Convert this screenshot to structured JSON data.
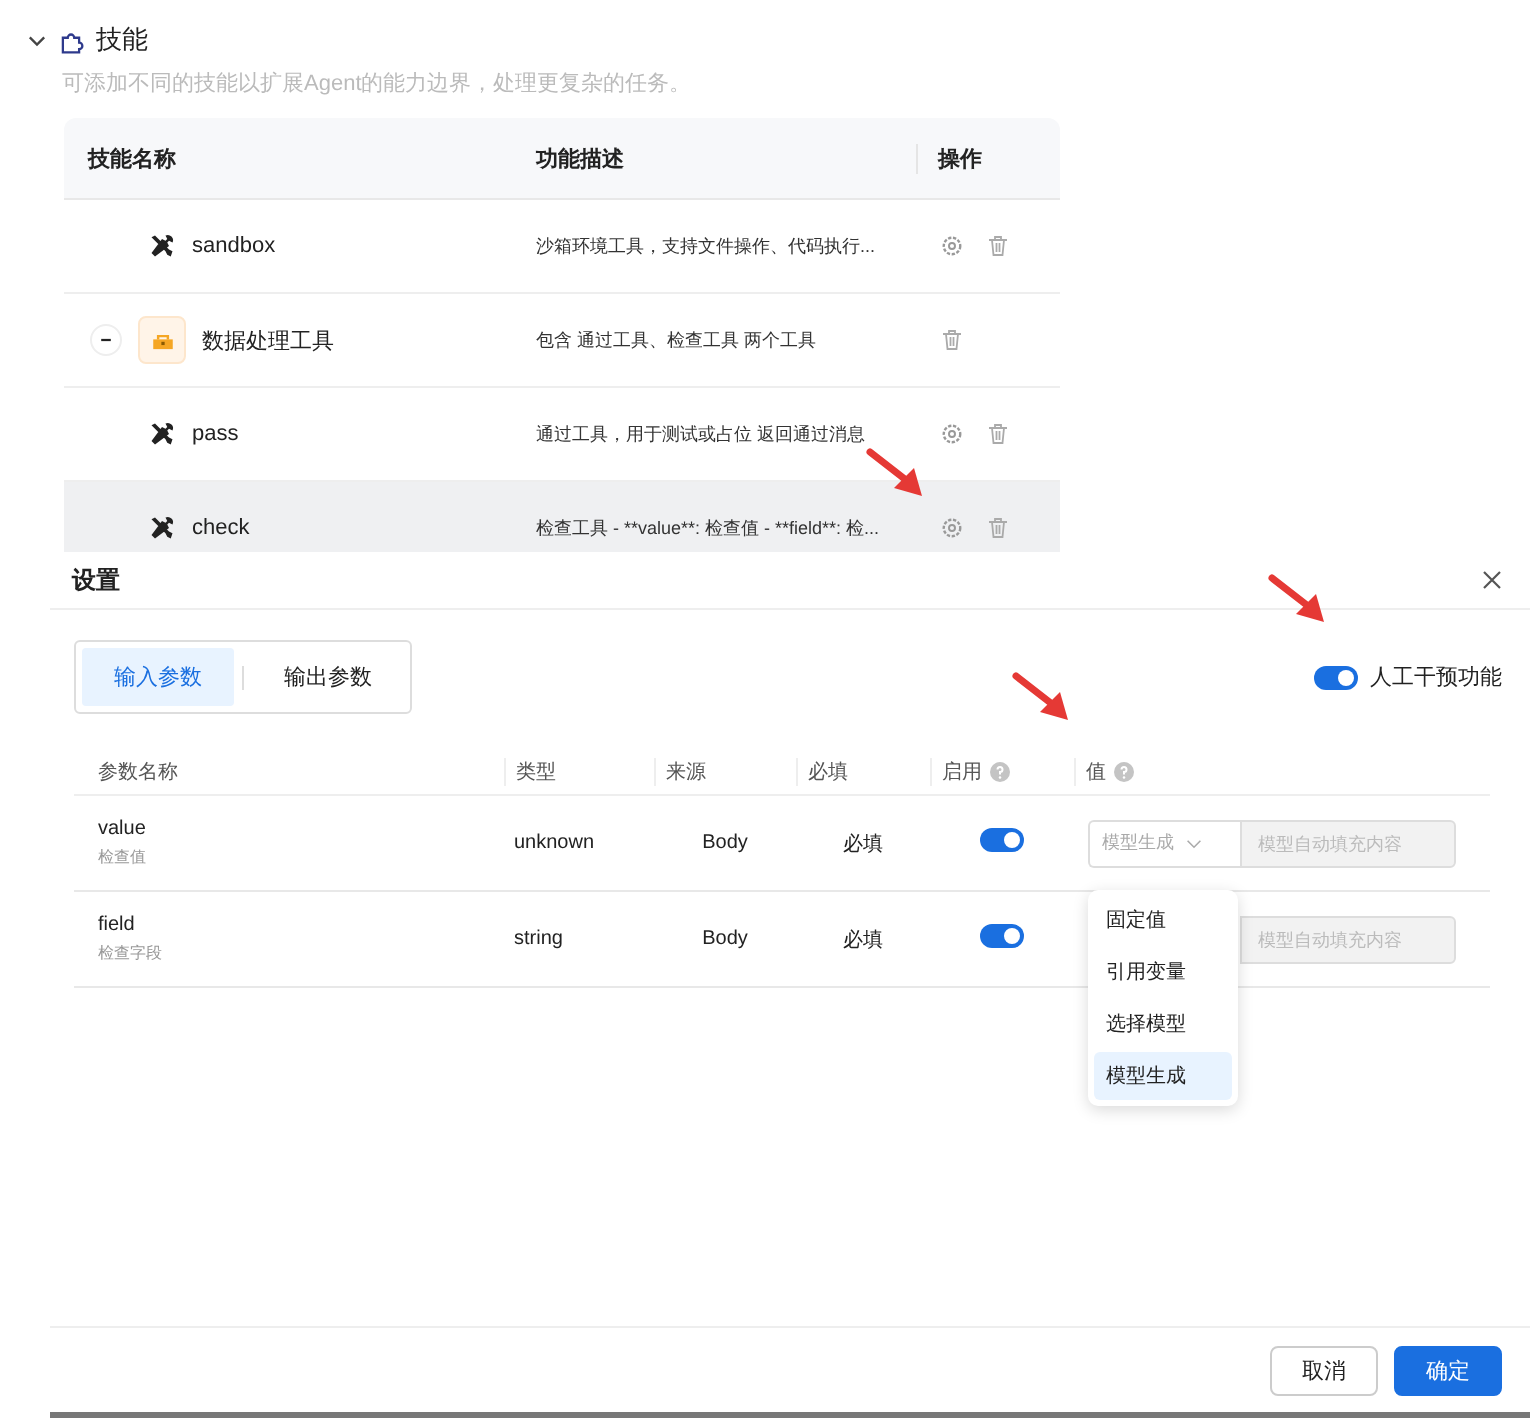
{
  "section": {
    "title": "技能",
    "expanded": true,
    "description": "可添加不同的技能以扩展Agent的能力边界，处理更复杂的任务。"
  },
  "skills_table": {
    "columns": [
      "技能名称",
      "功能描述",
      "操作"
    ],
    "rows": [
      {
        "kind": "tool",
        "name": "sandbox",
        "description": "沙箱环境工具，支持文件操作、代码执行...",
        "hovered": false
      },
      {
        "kind": "group",
        "name": "数据处理工具",
        "expanded": true,
        "description": "包含 通过工具、检查工具 两个工具",
        "hovered": false
      },
      {
        "kind": "tool",
        "name": "pass",
        "description": "通过工具，用于测试或占位 返回通过消息",
        "hovered": false
      },
      {
        "kind": "tool",
        "name": "check",
        "description": "检查工具 - **value**: 检查值 - **field**: 检...",
        "hovered": true
      }
    ]
  },
  "dialog": {
    "title": "设置",
    "tabs": [
      {
        "label": "输入参数",
        "selected": true
      },
      {
        "label": "输出参数",
        "selected": false
      }
    ],
    "manual_intervention": {
      "label": "人工干预功能",
      "on": true
    },
    "params_table": {
      "columns": [
        {
          "label": "参数名称",
          "help": false
        },
        {
          "label": "类型",
          "help": false
        },
        {
          "label": "来源",
          "help": false
        },
        {
          "label": "必填",
          "help": false
        },
        {
          "label": "启用",
          "help": true
        },
        {
          "label": "值",
          "help": true
        }
      ],
      "rows": [
        {
          "name": "value",
          "description": "检查值",
          "type": "unknown",
          "source": "Body",
          "required": "必填",
          "enabled": true,
          "value_mode": "模型生成",
          "value_placeholder": "模型自动填充内容"
        },
        {
          "name": "field",
          "description": "检查字段",
          "type": "string",
          "source": "Body",
          "required": "必填",
          "enabled": true,
          "value_placeholder": "模型自动填充内容"
        }
      ]
    },
    "value_mode_menu": {
      "items": [
        {
          "label": "固定值",
          "selected": false
        },
        {
          "label": "引用变量",
          "selected": false
        },
        {
          "label": "选择模型",
          "selected": false
        },
        {
          "label": "模型生成",
          "selected": true
        }
      ]
    },
    "buttons": [
      {
        "label": "取消",
        "kind": "secondary"
      },
      {
        "label": "确定",
        "kind": "primary"
      }
    ]
  }
}
